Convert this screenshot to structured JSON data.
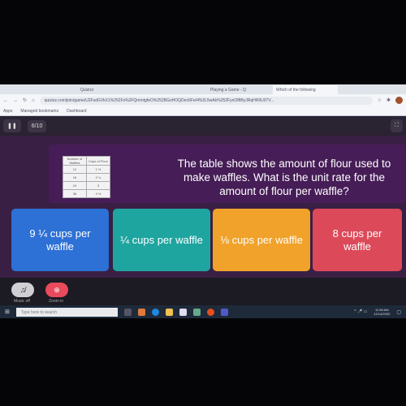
{
  "browser": {
    "tabs": [
      "Quizizz",
      "Playing a Game - Q",
      "Which of the following"
    ],
    "url": "quizizz.com/join/game/U2FsdGVkX1%252Fs%2FQmmtgfeO%252BGoHOQDeo5FeI4%2L5wAk%252FynOf8ByJRqHR9U07V...",
    "bookmarks": [
      "Apps",
      "Managed bookmarks",
      "Dashboard"
    ]
  },
  "quiz": {
    "progress": "6/10",
    "question": "The table shows the amount of flour used to make waffles. What is the unit rate for the amount of flour per waffle?",
    "table": {
      "headers": [
        "Number of Waffles",
        "Cups of Flour"
      ],
      "rows": [
        [
          "12",
          "1 ½"
        ],
        [
          "18",
          "2 ¼"
        ],
        [
          "24",
          "3"
        ],
        [
          "36",
          "4 ½"
        ]
      ]
    },
    "options": [
      {
        "label": "9 ¼ cups per waffle",
        "color": "#2d70d6"
      },
      {
        "label": "¼ cups per waffle",
        "color": "#1fa5a0"
      },
      {
        "label": "⅛ cups per waffle",
        "color": "#f0a22a"
      },
      {
        "label": "8 cups per waffle",
        "color": "#dc4a5a"
      }
    ],
    "controls": [
      "Music off",
      "Zoom in"
    ]
  },
  "taskbar": {
    "search_placeholder": "Type here to search",
    "time": "11:58 AM",
    "date": "12/14/2020"
  }
}
